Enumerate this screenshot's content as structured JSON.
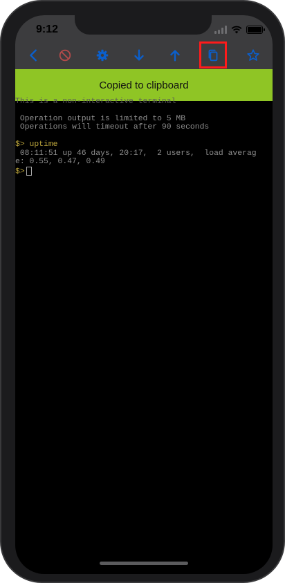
{
  "status_bar": {
    "time": "9:12"
  },
  "toolbar": {
    "buttons": [
      {
        "icon": "back-icon"
      },
      {
        "icon": "stop-icon"
      },
      {
        "icon": "settings-icon"
      },
      {
        "icon": "arrow-down-icon"
      },
      {
        "icon": "arrow-up-icon"
      },
      {
        "icon": "copy-icon",
        "highlighted": true
      },
      {
        "icon": "star-icon"
      }
    ]
  },
  "toast": {
    "message": "Copied to clipboard"
  },
  "terminal": {
    "partial_line": "This is a non-interactive terminal",
    "info_line_1": " Operation output is limited to 5 MB",
    "info_line_2": " Operations will timeout after 90 seconds",
    "prompt_symbol": "$>",
    "command": " uptime",
    "output_line_1": " 08:11:51 up 46 days, 20:17,  2 users,  load averag",
    "output_line_2": "e: 0.55, 0.47, 0.49",
    "current_prompt": "$>"
  },
  "colors": {
    "accent_blue": "#0b5fcc",
    "toast_green": "#8fc525",
    "highlight_red": "#ff1b1b",
    "prompt_yellow": "#b8a23b"
  }
}
